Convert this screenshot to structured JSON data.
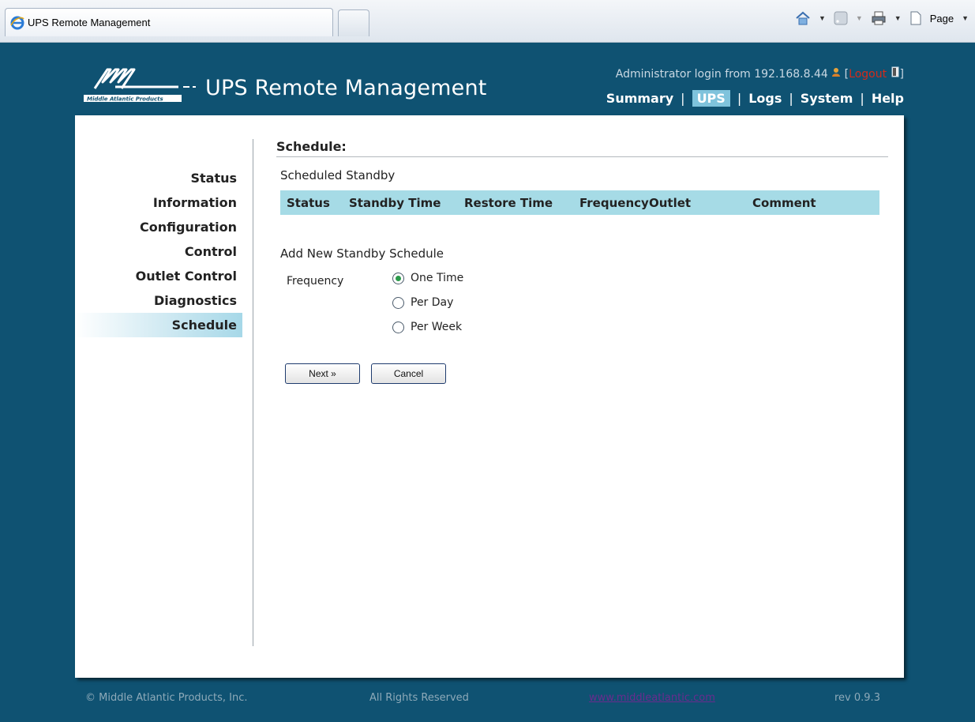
{
  "browser": {
    "tab_title": "UPS Remote Management",
    "page_menu": "Page"
  },
  "header": {
    "logo_text": "Middle Atlantic Products",
    "app_title": "UPS Remote Management",
    "login_prefix": "Administrator login from 192.168.8.44",
    "logout_label": "Logout",
    "nav": {
      "summary": "Summary",
      "ups": "UPS",
      "logs": "Logs",
      "system": "System",
      "help": "Help"
    }
  },
  "sidebar": {
    "items": [
      {
        "label": "Status"
      },
      {
        "label": "Information"
      },
      {
        "label": "Configuration"
      },
      {
        "label": "Control"
      },
      {
        "label": "Outlet Control"
      },
      {
        "label": "Diagnostics"
      },
      {
        "label": "Schedule",
        "active": true
      }
    ]
  },
  "main": {
    "section_title": "Schedule:",
    "scheduled_title": "Scheduled Standby",
    "columns": [
      "Status",
      "Standby Time",
      "Restore Time",
      "Frequency",
      "Outlet",
      "Comment"
    ],
    "add_title": "Add New Standby Schedule",
    "frequency_label": "Frequency",
    "frequency_options": [
      {
        "label": "One Time",
        "selected": true
      },
      {
        "label": "Per Day",
        "selected": false
      },
      {
        "label": "Per Week",
        "selected": false
      }
    ],
    "next_button": "Next »",
    "cancel_button": "Cancel"
  },
  "footer": {
    "copyright": "© Middle Atlantic Products, Inc.",
    "rights": "All Rights Reserved",
    "website": "www.middleatlantic.com",
    "version": "rev 0.9.3"
  },
  "colors": {
    "background": "#0f5272",
    "header_bar": "#a6dbe6",
    "nav_active": "#7fc3dc",
    "logout": "#d42a1a",
    "radio_selected": "#2b9a4a"
  }
}
